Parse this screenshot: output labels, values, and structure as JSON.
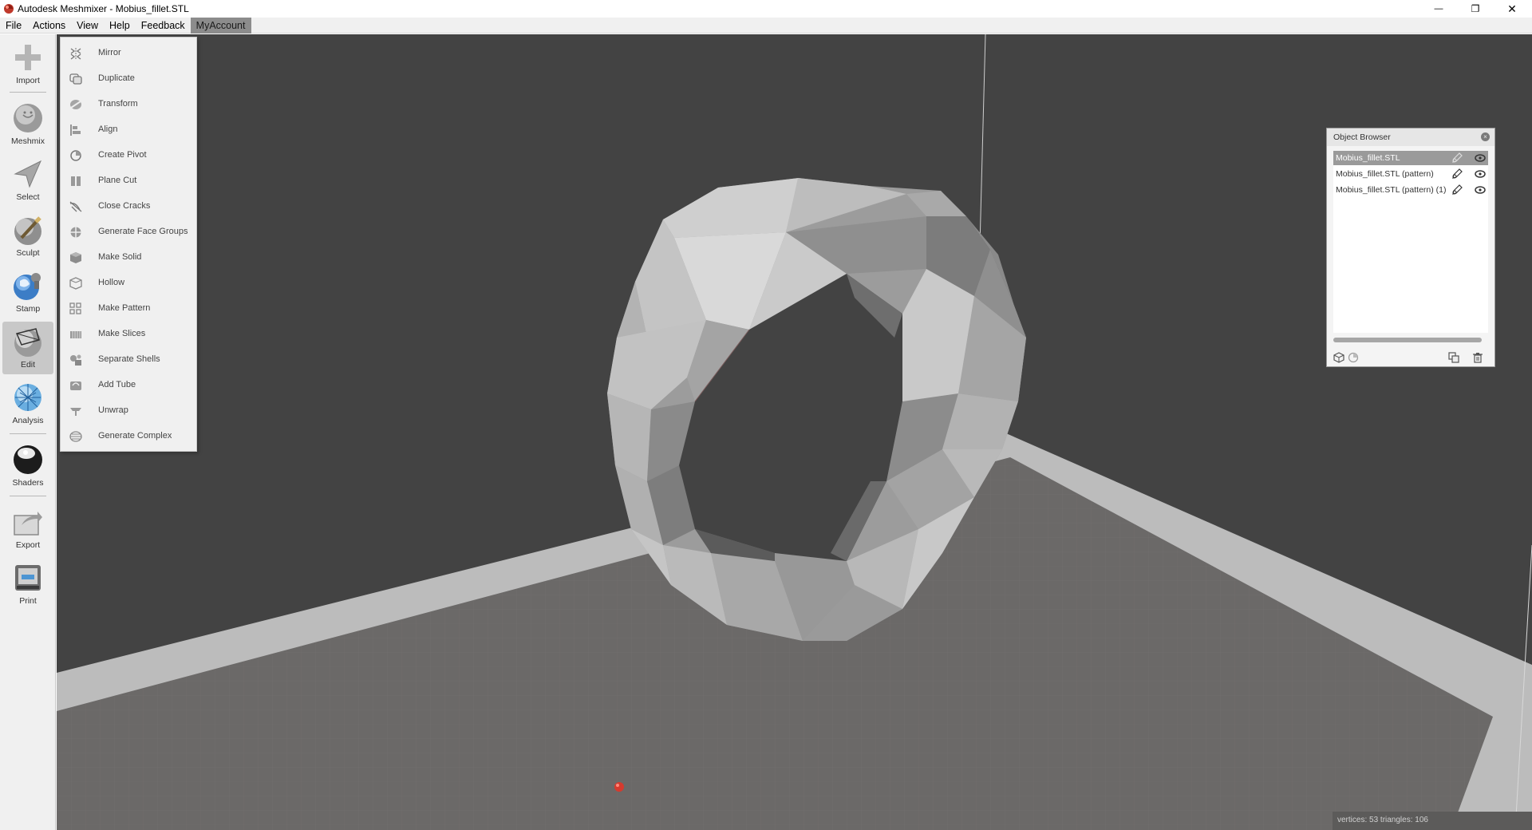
{
  "window": {
    "title": "Autodesk Meshmixer - Mobius_fillet.STL",
    "minimize_glyph": "—",
    "restore_glyph": "❐",
    "close_glyph": "✕"
  },
  "menubar": {
    "items": [
      "File",
      "Actions",
      "View",
      "Help",
      "Feedback",
      "MyAccount"
    ]
  },
  "toolbar": {
    "tools": [
      {
        "label": "Import",
        "icon": "plus-icon"
      },
      {
        "label": "Meshmix",
        "icon": "face-sphere-icon"
      },
      {
        "label": "Select",
        "icon": "arrow-cursor-icon"
      },
      {
        "label": "Sculpt",
        "icon": "brush-sphere-icon"
      },
      {
        "label": "Stamp",
        "icon": "stamp-sphere-icon"
      },
      {
        "label": "Edit",
        "icon": "edit-sphere-icon",
        "active": true
      },
      {
        "label": "Analysis",
        "icon": "mesh-sphere-icon"
      },
      {
        "label": "Shaders",
        "icon": "shaded-sphere-icon"
      },
      {
        "label": "Export",
        "icon": "export-folder-icon"
      },
      {
        "label": "Print",
        "icon": "printer-icon"
      }
    ]
  },
  "edit_menu": {
    "items": [
      {
        "label": "Mirror",
        "icon": "mirror-icon"
      },
      {
        "label": "Duplicate",
        "icon": "duplicate-icon"
      },
      {
        "label": "Transform",
        "icon": "transform-icon"
      },
      {
        "label": "Align",
        "icon": "align-icon"
      },
      {
        "label": "Create Pivot",
        "icon": "pivot-icon"
      },
      {
        "label": "Plane Cut",
        "icon": "plane-cut-icon"
      },
      {
        "label": "Close Cracks",
        "icon": "close-cracks-icon"
      },
      {
        "label": "Generate Face Groups",
        "icon": "face-groups-icon"
      },
      {
        "label": "Make Solid",
        "icon": "make-solid-icon"
      },
      {
        "label": "Hollow",
        "icon": "hollow-icon"
      },
      {
        "label": "Make Pattern",
        "icon": "make-pattern-icon"
      },
      {
        "label": "Make Slices",
        "icon": "make-slices-icon"
      },
      {
        "label": "Separate Shells",
        "icon": "separate-shells-icon"
      },
      {
        "label": "Add Tube",
        "icon": "add-tube-icon"
      },
      {
        "label": "Unwrap",
        "icon": "unwrap-icon"
      },
      {
        "label": "Generate Complex",
        "icon": "generate-complex-icon"
      }
    ]
  },
  "object_browser": {
    "title": "Object Browser",
    "items": [
      {
        "label": "Mobius_fillet.STL",
        "selected": true
      },
      {
        "label": "Mobius_fillet.STL (pattern)",
        "selected": false
      },
      {
        "label": "Mobius_fillet.STL (pattern) (1)",
        "selected": false
      }
    ]
  },
  "status": {
    "text": "vertices: 53 triangles: 106"
  },
  "colors": {
    "viewport_bg": "#434343",
    "bed_floor": "#6b6968",
    "bed_border": "#bcbcbc",
    "mesh_light": "#d8d8d8",
    "mesh_dark": "#7a7a7a",
    "pivot_dot": "#d63a2e"
  }
}
